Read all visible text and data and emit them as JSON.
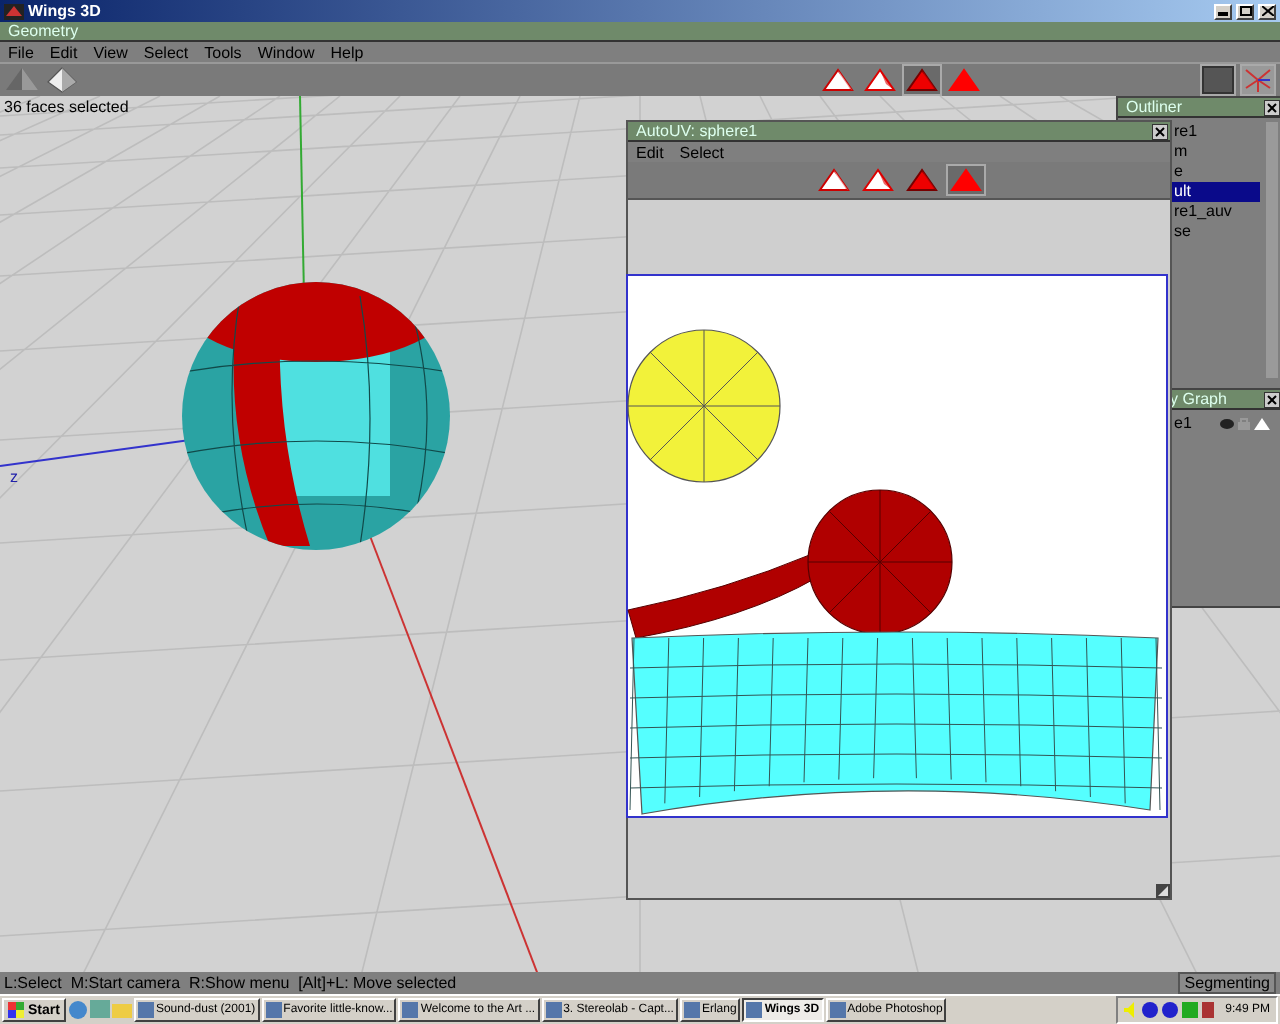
{
  "window": {
    "title": "Wings 3D"
  },
  "geometry_title": "Geometry",
  "menu": [
    "File",
    "Edit",
    "View",
    "Select",
    "Tools",
    "Window",
    "Help"
  ],
  "selection_modes": [
    {
      "kind": "vertex",
      "selected": false
    },
    {
      "kind": "edge",
      "selected": false
    },
    {
      "kind": "face",
      "selected": true
    },
    {
      "kind": "body",
      "selected": false
    }
  ],
  "viewport": {
    "info": "36 faces selected",
    "axis_label": "z"
  },
  "autouv": {
    "title": "AutoUV: sphere1",
    "menu": [
      "Edit",
      "Select"
    ],
    "selection_modes": [
      {
        "kind": "vertex",
        "selected": false
      },
      {
        "kind": "edge",
        "selected": false
      },
      {
        "kind": "face",
        "selected": false
      },
      {
        "kind": "body",
        "selected": true
      }
    ]
  },
  "outliner": {
    "title": "Outliner",
    "items": [
      {
        "label": "re1",
        "selected": false
      },
      {
        "label": "m",
        "selected": false
      },
      {
        "label": "e",
        "selected": false
      },
      {
        "label": "ult",
        "selected": true
      },
      {
        "label": "re1_auv",
        "selected": false
      },
      {
        "label": "se",
        "selected": false
      }
    ]
  },
  "graph": {
    "title": "y Graph",
    "items": [
      {
        "label": "e1"
      }
    ]
  },
  "status_bar": {
    "hint": "L:Select  M:Start camera  R:Show menu  [Alt]+L: Move selected",
    "mode": "Segmenting"
  },
  "taskbar": {
    "start": "Start",
    "tasks": [
      {
        "label": "Sound-dust (2001)",
        "selected": false
      },
      {
        "label": "Favorite little-know...",
        "selected": false
      },
      {
        "label": "Welcome to the Art ...",
        "selected": false
      },
      {
        "label": "3. Stereolab - Capt...",
        "selected": false
      },
      {
        "label": "Erlang",
        "selected": false
      },
      {
        "label": "Wings 3D",
        "selected": true
      },
      {
        "label": "Adobe Photoshop",
        "selected": false
      }
    ],
    "clock": "9:49 PM"
  }
}
